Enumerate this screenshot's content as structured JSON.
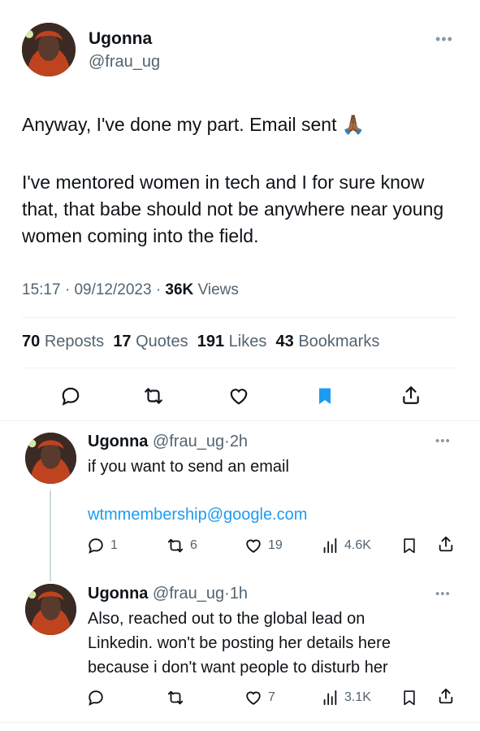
{
  "main_tweet": {
    "author_name": "Ugonna",
    "author_handle": "@frau_ug",
    "line1": "Anyway, I've done my part. Email sent 🙏🏾",
    "paragraph2": "I've mentored women in tech and I for sure know that, that babe should not be anywhere near young women coming into the field.",
    "time": "15:17",
    "date": "09/12/2023",
    "views_count": "36K",
    "views_label": "Views",
    "reposts_count": "70",
    "reposts_label": "Reposts",
    "quotes_count": "17",
    "quotes_label": "Quotes",
    "likes_count": "191",
    "likes_label": "Likes",
    "bookmarks_count": "43",
    "bookmarks_label": "Bookmarks",
    "sep": "·"
  },
  "replies": [
    {
      "author_name": "Ugonna",
      "author_handle": "@frau_ug",
      "age": "2h",
      "text": "if you want to send an email",
      "link": "wtmmembership@google.com",
      "reply_count": "1",
      "repost_count": "6",
      "like_count": "19",
      "view_count": "4.6K"
    },
    {
      "author_name": "Ugonna",
      "author_handle": "@frau_ug",
      "age": "1h",
      "text_line1": "Also, reached out to the global lead on",
      "text_line2": "Linkedin. won't be posting her details here",
      "text_line3": "because i don't want people to disturb her",
      "reply_count": "",
      "repost_count": "",
      "like_count": "7",
      "view_count": "3.1K"
    }
  ],
  "colors": {
    "accent": "#1d9bf0",
    "text": "#0f1419",
    "secondary": "#536471",
    "divider": "#eff3f4"
  },
  "icons": {
    "reply": "reply-icon",
    "repost": "repost-icon",
    "like": "heart-icon",
    "bookmark": "bookmark-icon",
    "share": "share-icon",
    "views": "views-icon",
    "more": "more-icon"
  }
}
